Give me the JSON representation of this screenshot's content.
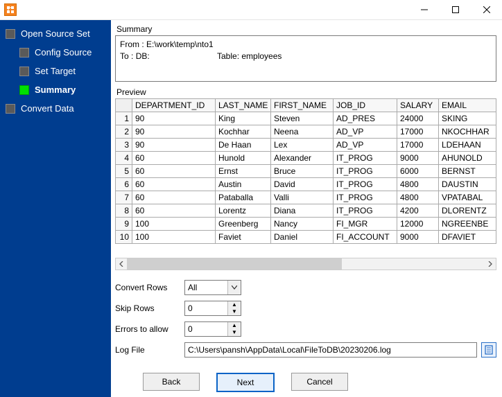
{
  "sidebar": {
    "items": [
      {
        "label": "Open Source Set"
      },
      {
        "label": "Config Source"
      },
      {
        "label": "Set Target"
      },
      {
        "label": "Summary"
      },
      {
        "label": "Convert Data"
      }
    ]
  },
  "summary": {
    "label": "Summary",
    "from_label": "From : ",
    "from_path": "E:\\work\\temp\\nto1",
    "to_label": "To : ",
    "to_db": "DB:",
    "table_label": "Table: ",
    "table_name": "employees"
  },
  "preview": {
    "label": "Preview",
    "columns": [
      "DEPARTMENT_ID",
      "LAST_NAME",
      "FIRST_NAME",
      "JOB_ID",
      "SALARY",
      "EMAIL"
    ],
    "rows": [
      [
        "90",
        "King",
        "Steven",
        "AD_PRES",
        "24000",
        "SKING"
      ],
      [
        "90",
        "Kochhar",
        "Neena",
        "AD_VP",
        "17000",
        "NKOCHHAR"
      ],
      [
        "90",
        "De Haan",
        "Lex",
        "AD_VP",
        "17000",
        "LDEHAAN"
      ],
      [
        "60",
        "Hunold",
        "Alexander",
        "IT_PROG",
        "9000",
        "AHUNOLD"
      ],
      [
        "60",
        "Ernst",
        "Bruce",
        "IT_PROG",
        "6000",
        "BERNST"
      ],
      [
        "60",
        "Austin",
        "David",
        "IT_PROG",
        "4800",
        "DAUSTIN"
      ],
      [
        "60",
        "Pataballa",
        "Valli",
        "IT_PROG",
        "4800",
        "VPATABAL"
      ],
      [
        "60",
        "Lorentz",
        "Diana",
        "IT_PROG",
        "4200",
        "DLORENTZ"
      ],
      [
        "100",
        "Greenberg",
        "Nancy",
        "FI_MGR",
        "12000",
        "NGREENBE"
      ],
      [
        "100",
        "Faviet",
        "Daniel",
        "FI_ACCOUNT",
        "9000",
        "DFAVIET"
      ]
    ]
  },
  "form": {
    "convert_rows": {
      "label": "Convert Rows",
      "value": "All"
    },
    "skip_rows": {
      "label": "Skip Rows",
      "value": "0"
    },
    "errors": {
      "label": "Errors to allow",
      "value": "0"
    },
    "log_file": {
      "label": "Log File",
      "value": "C:\\Users\\pansh\\AppData\\Local\\FileToDB\\20230206.log"
    }
  },
  "buttons": {
    "back": "Back",
    "next": "Next",
    "cancel": "Cancel"
  }
}
